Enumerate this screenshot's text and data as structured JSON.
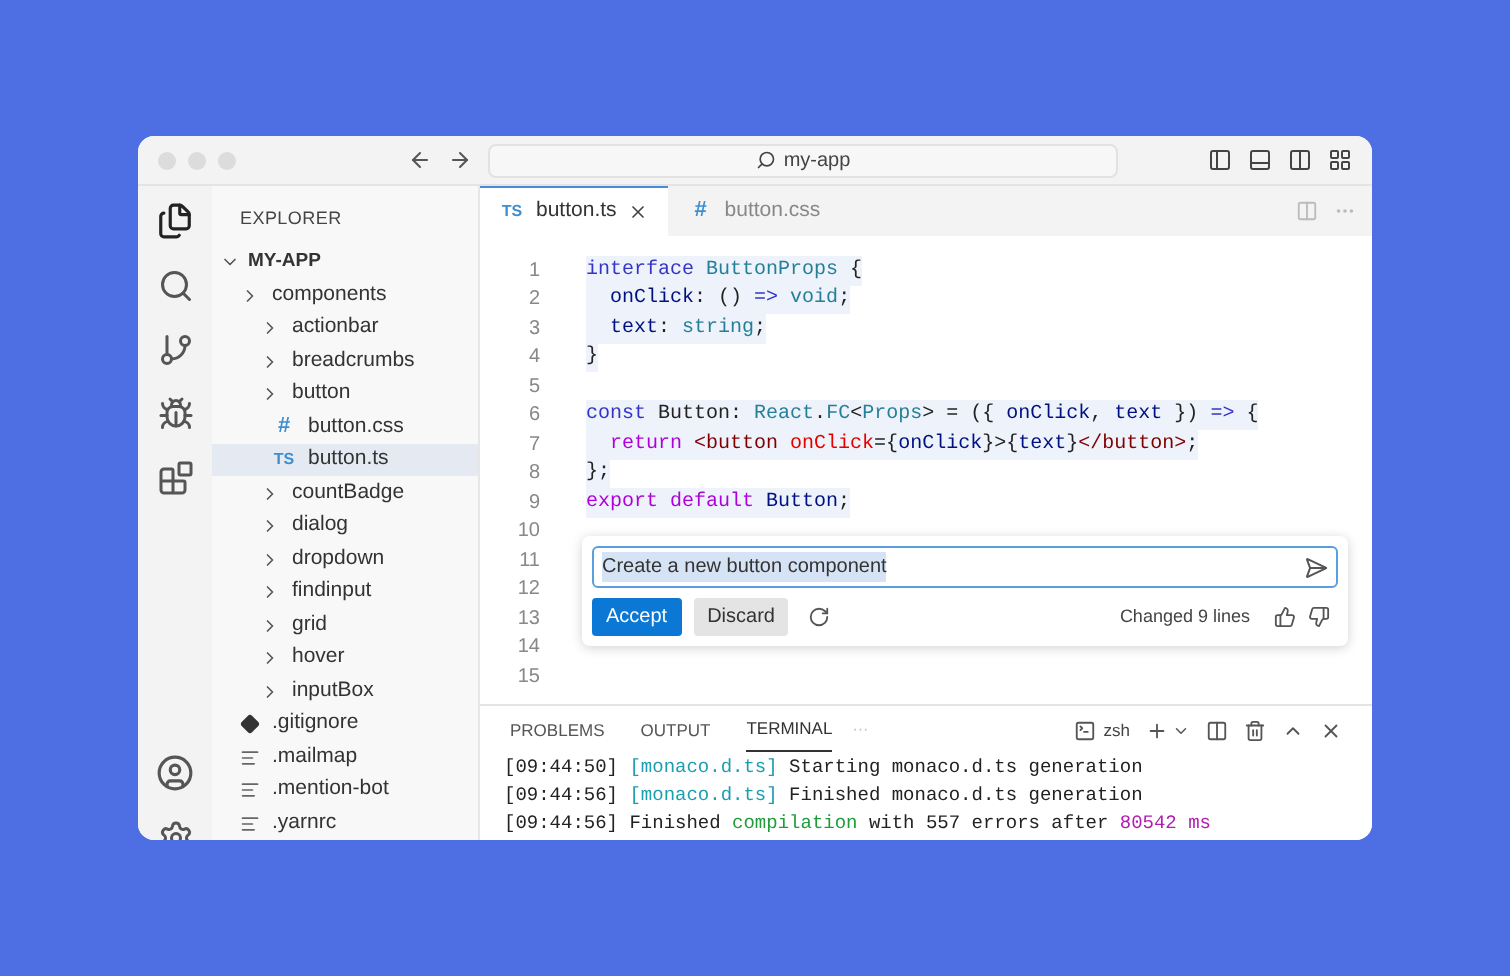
{
  "title_bar": {
    "search": "my-app"
  },
  "sidebar": {
    "title": "EXPLORER",
    "root": {
      "label": "MY-APP",
      "expanded": true
    },
    "items": [
      {
        "label": "components",
        "kind": "folder",
        "selected": false,
        "children": [
          {
            "label": "actionbar",
            "kind": "folder",
            "selected": false
          },
          {
            "label": "breadcrumbs",
            "kind": "folder",
            "selected": false
          },
          {
            "label": "button",
            "kind": "folder",
            "selected": false,
            "children": [
              {
                "label": "button.css",
                "kind": "css",
                "badge": "#",
                "selected": false
              },
              {
                "label": "button.ts",
                "kind": "ts",
                "badge": "TS",
                "selected": true
              }
            ]
          },
          {
            "label": "countBadge",
            "kind": "folder",
            "selected": false
          },
          {
            "label": "dialog",
            "kind": "folder",
            "selected": false
          },
          {
            "label": "dropdown",
            "kind": "folder",
            "selected": false
          },
          {
            "label": "findinput",
            "kind": "folder",
            "selected": false
          },
          {
            "label": "grid",
            "kind": "folder",
            "selected": false
          },
          {
            "label": "hover",
            "kind": "folder",
            "selected": false
          },
          {
            "label": "inputBox",
            "kind": "folder",
            "selected": false
          }
        ]
      },
      {
        "label": ".gitignore",
        "kind": "git",
        "selected": false
      },
      {
        "label": ".mailmap",
        "kind": "text",
        "selected": false
      },
      {
        "label": ".mention-bot",
        "kind": "text",
        "selected": false
      },
      {
        "label": ".yarnrc",
        "kind": "text",
        "selected": false
      }
    ]
  },
  "tabs": [
    {
      "label": "button.ts",
      "badge": "TS",
      "kind": "ts",
      "selected": true
    },
    {
      "label": "button.css",
      "badge": "#",
      "kind": "css",
      "selected": false
    }
  ],
  "editor": {
    "lines": [
      {
        "number": "1",
        "tokens": [
          {
            "text": "interface",
            "kind": "kw"
          },
          {
            "text": " ButtonProps",
            "kind": "type"
          },
          {
            "text": " {",
            "kind": "plain"
          }
        ]
      },
      {
        "number": "2",
        "tokens": [
          {
            "text": "  onClick",
            "kind": "var"
          },
          {
            "text": ": () ",
            "kind": "plain"
          },
          {
            "text": "=>",
            "kind": "kw"
          },
          {
            "text": " void",
            "kind": "type"
          },
          {
            "text": ";",
            "kind": "plain"
          }
        ]
      },
      {
        "number": "3",
        "tokens": [
          {
            "text": "  text",
            "kind": "var"
          },
          {
            "text": ": ",
            "kind": "plain"
          },
          {
            "text": "string",
            "kind": "type"
          },
          {
            "text": ";",
            "kind": "plain"
          }
        ]
      },
      {
        "number": "4",
        "tokens": [
          {
            "text": "}",
            "kind": "plain"
          }
        ]
      },
      {
        "number": "5"
      },
      {
        "number": "6",
        "tokens": [
          {
            "text": "const",
            "kind": "kw"
          },
          {
            "text": " Button: ",
            "kind": "plain"
          },
          {
            "text": "React",
            "kind": "type"
          },
          {
            "text": ".",
            "kind": "plain"
          },
          {
            "text": "FC",
            "kind": "type"
          },
          {
            "text": "<",
            "kind": "plain"
          },
          {
            "text": "Props",
            "kind": "type"
          },
          {
            "text": "> = ({ ",
            "kind": "plain"
          },
          {
            "text": "onClick",
            "kind": "var"
          },
          {
            "text": ", ",
            "kind": "plain"
          },
          {
            "text": "text",
            "kind": "var"
          },
          {
            "text": " }) ",
            "kind": "plain"
          },
          {
            "text": "=>",
            "kind": "kw"
          },
          {
            "text": " {",
            "kind": "plain"
          }
        ]
      },
      {
        "number": "7",
        "tokens": [
          {
            "text": "  return",
            "kind": "ctrl"
          },
          {
            "text": " <button",
            "kind": "tag"
          },
          {
            "text": " onClick",
            "kind": "attr"
          },
          {
            "text": "={",
            "kind": "plain"
          },
          {
            "text": "onClick",
            "kind": "var"
          },
          {
            "text": "}>{",
            "kind": "plain"
          },
          {
            "text": "text",
            "kind": "var"
          },
          {
            "text": "}",
            "kind": "plain"
          },
          {
            "text": "</button>",
            "kind": "tag"
          },
          {
            "text": ";",
            "kind": "plain"
          }
        ]
      },
      {
        "number": "8",
        "tokens": [
          {
            "text": "};",
            "kind": "plain"
          }
        ]
      },
      {
        "number": "9",
        "tokens": [
          {
            "text": "export default",
            "kind": "ctrl"
          },
          {
            "text": " Button",
            "kind": "var"
          },
          {
            "text": ";",
            "kind": "plain"
          }
        ]
      },
      {
        "number": "10"
      },
      {
        "number": "11"
      },
      {
        "number": "12"
      },
      {
        "number": "13"
      },
      {
        "number": "14"
      },
      {
        "number": "15"
      }
    ]
  },
  "inline_chat": {
    "value": "Create a new button component",
    "accept": "Accept",
    "discard": "Discard",
    "status": "Changed 9 lines"
  },
  "panel": {
    "tabs": [
      {
        "label": "PROBLEMS",
        "selected": false
      },
      {
        "label": "OUTPUT",
        "selected": false
      },
      {
        "label": "TERMINAL",
        "selected": true
      }
    ],
    "more": "···",
    "shell": "zsh",
    "lines": [
      [
        {
          "text": "[09:44:50] ",
          "kind": "plain"
        },
        {
          "text": "[monaco.d.ts]",
          "kind": "teal"
        },
        {
          "text": " Starting monaco.d.ts generation",
          "kind": "plain"
        }
      ],
      [
        {
          "text": "[09:44:56] ",
          "kind": "plain"
        },
        {
          "text": "[monaco.d.ts]",
          "kind": "teal"
        },
        {
          "text": " Finished monaco.d.ts generation",
          "kind": "plain"
        }
      ],
      [
        {
          "text": "[09:44:56] Finished ",
          "kind": "plain"
        },
        {
          "text": "compilation",
          "kind": "green"
        },
        {
          "text": " with 557 errors after ",
          "kind": "plain"
        },
        {
          "text": "80542 ms",
          "kind": "magenta"
        }
      ]
    ]
  }
}
